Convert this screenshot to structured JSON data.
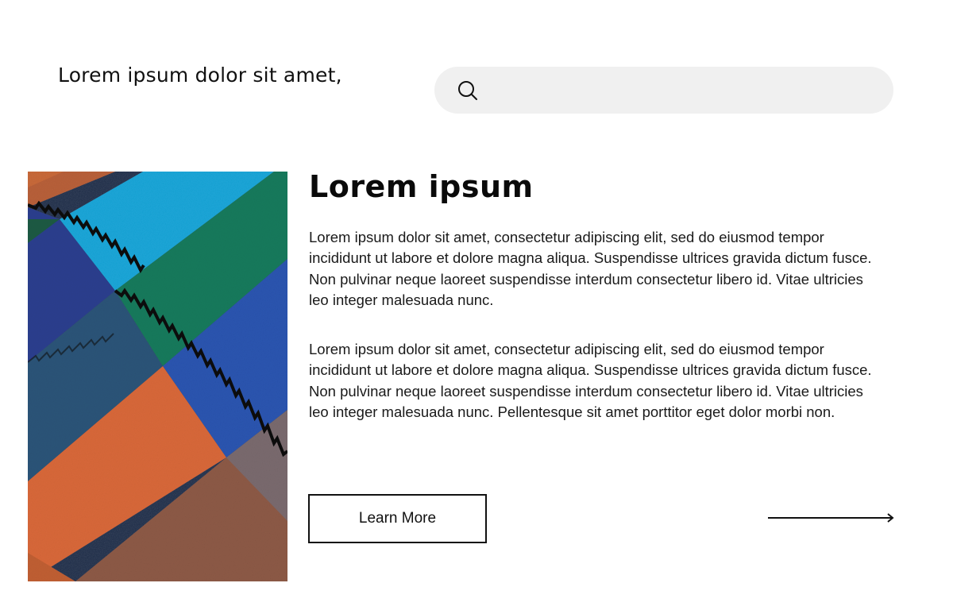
{
  "header": {
    "title": "Lorem ipsum dolor sit amet,"
  },
  "search": {
    "icon": "search-icon",
    "value": "",
    "placeholder": ""
  },
  "hero_image": {
    "subject": "leather-swatches",
    "colors": [
      "#c8693a",
      "#1aa6d8",
      "#167a5c",
      "#2c3f8e",
      "#2c5478",
      "#2a55b0",
      "#d8683a",
      "#8d5a46",
      "#7a6a6e"
    ]
  },
  "main": {
    "title": "Lorem ipsum",
    "paragraphs": [
      "Lorem ipsum dolor sit amet, consectetur adipiscing elit, sed do eiusmod tempor incididunt ut labore et dolore magna aliqua. Suspendisse ultrices gravida dictum fusce. Non pulvinar neque laoreet suspendisse interdum consectetur libero id. Vitae ultricies leo integer malesuada nunc.",
      "Lorem ipsum dolor sit amet, consectetur adipiscing elit, sed do eiusmod tempor incididunt ut labore et dolore magna aliqua. Suspendisse ultrices gravida dictum fusce. Non pulvinar neque laoreet suspendisse interdum consectetur libero id. Vitae ultricies leo integer malesuada nunc. Pellentesque sit amet porttitor eget dolor morbi non."
    ],
    "button_label": "Learn More",
    "arrow_icon": "arrow-right-icon"
  },
  "colors": {
    "background": "#ffffff",
    "search_bg": "#f0f0f0",
    "text": "#111111"
  }
}
